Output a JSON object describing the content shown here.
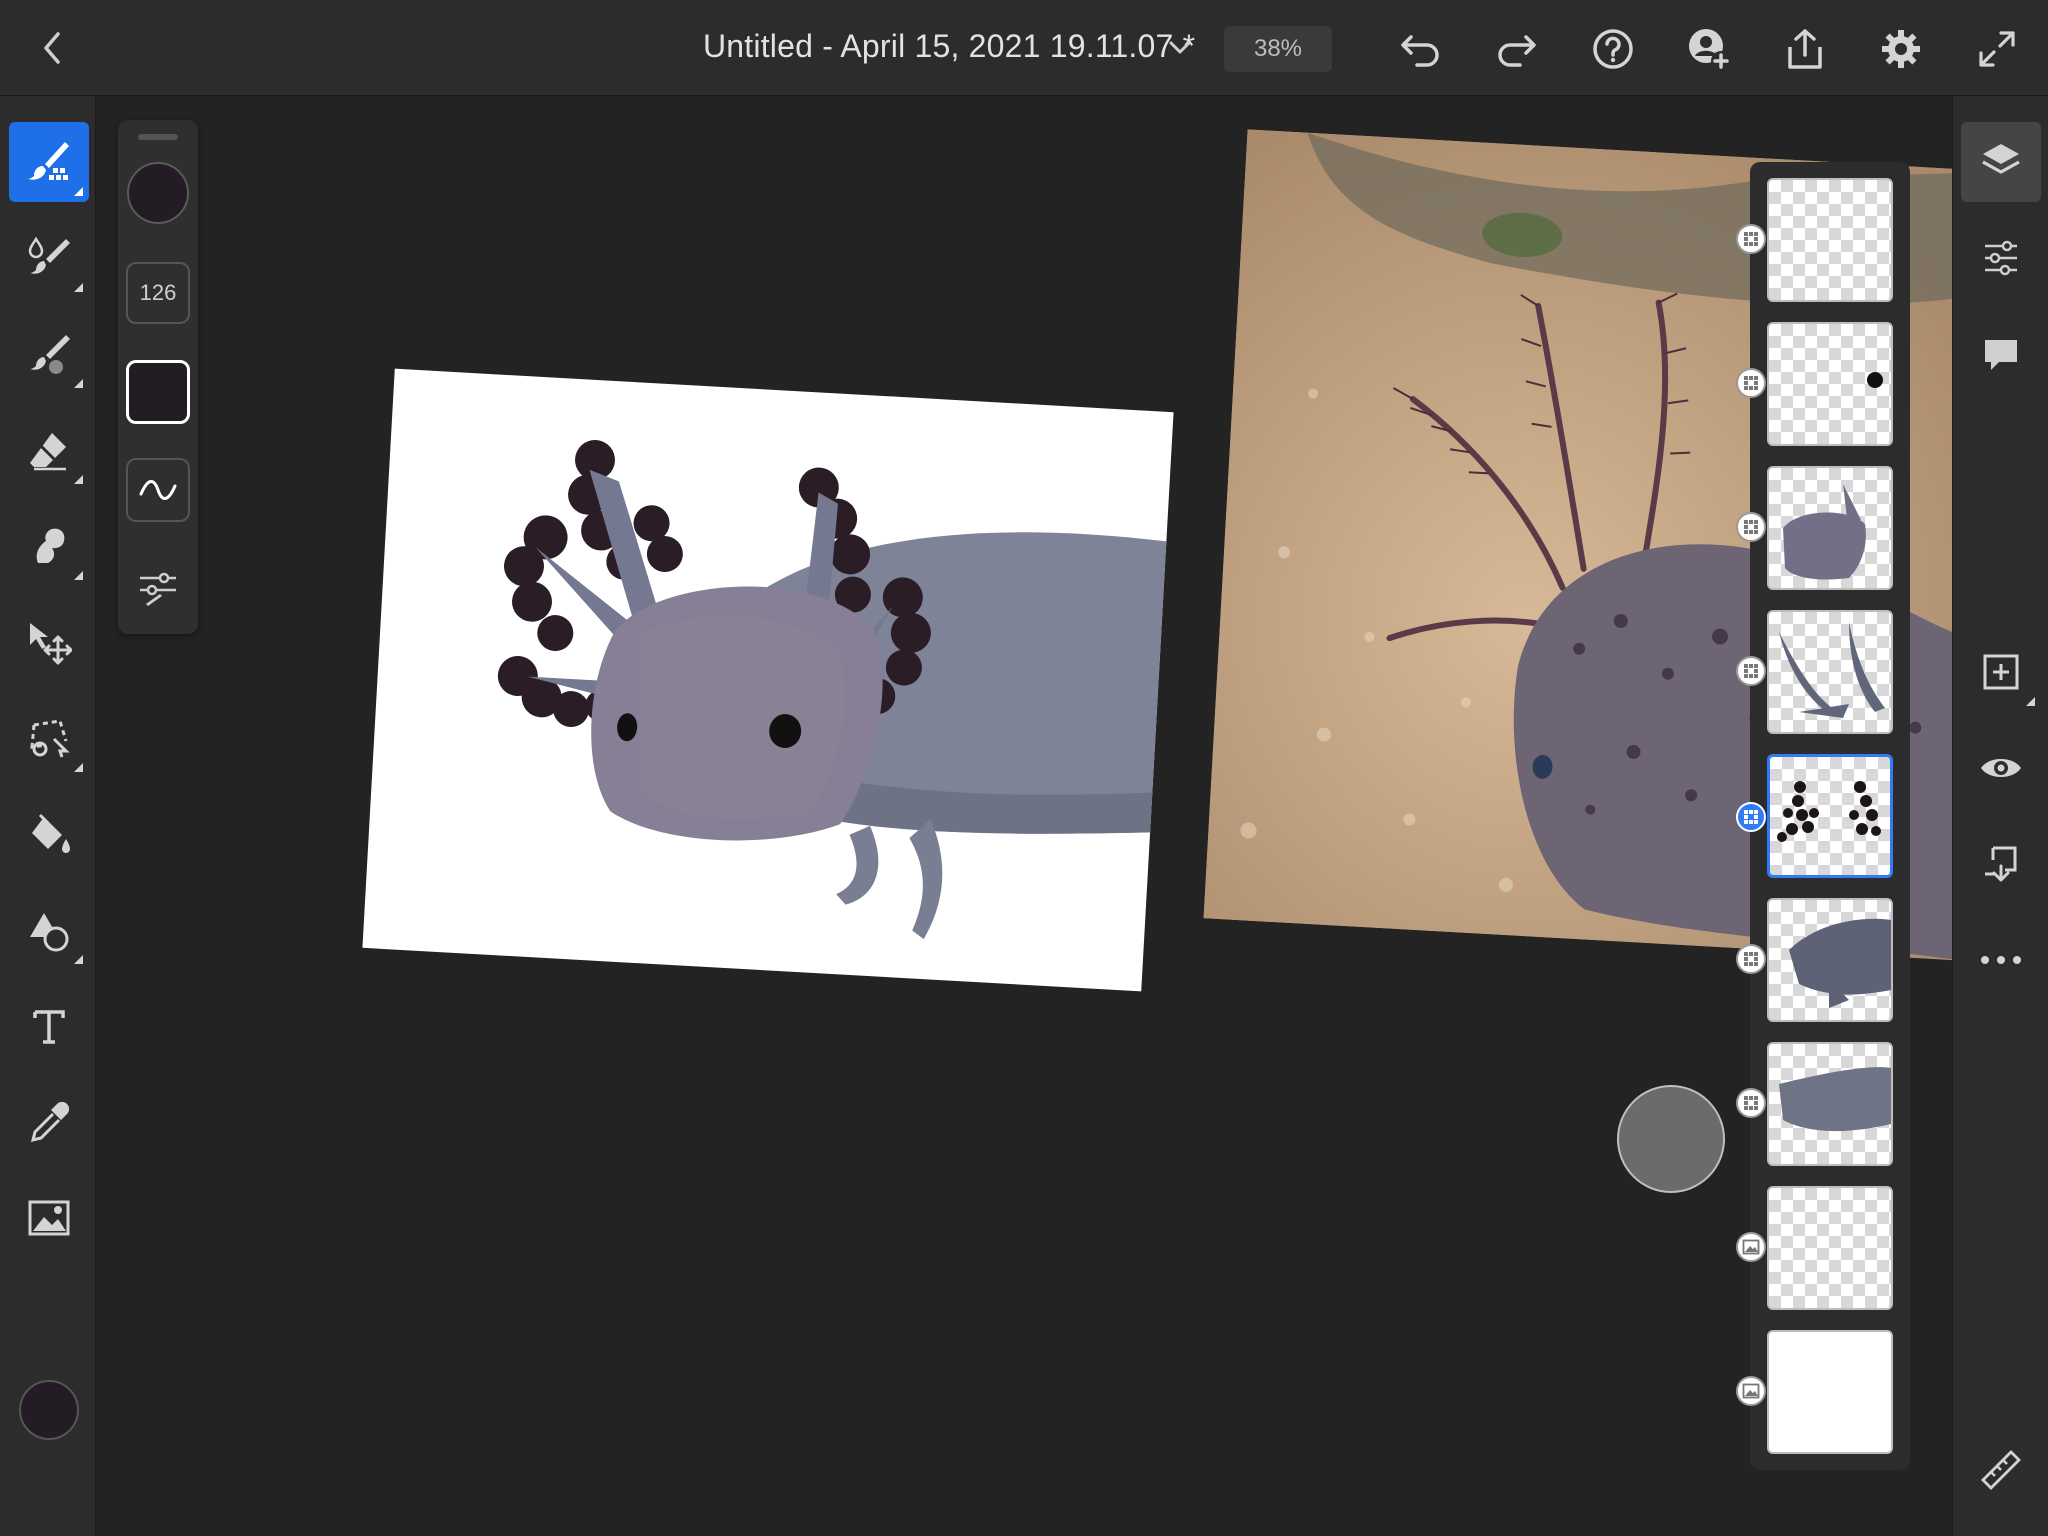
{
  "app": {
    "document_title": "Untitled - April 15, 2021 19.11.07 *",
    "zoom_level": "38%"
  },
  "topbar": {
    "icons": [
      "back-icon",
      "chevron-down-icon",
      "undo-icon",
      "redo-icon",
      "help-icon",
      "invite-icon",
      "share-icon",
      "gear-icon",
      "fullscreen-icon"
    ]
  },
  "tools": [
    {
      "name": "paint-brush",
      "icon": "paint-brush-icon",
      "active": true
    },
    {
      "name": "smudge",
      "icon": "smudge-brush-icon",
      "active": false
    },
    {
      "name": "mixer",
      "icon": "mixer-brush-icon",
      "active": false
    },
    {
      "name": "eraser",
      "icon": "eraser-icon",
      "active": false
    },
    {
      "name": "liquify",
      "icon": "liquify-icon",
      "active": false
    },
    {
      "name": "transform",
      "icon": "move-icon",
      "active": false
    },
    {
      "name": "selection",
      "icon": "lasso-icon",
      "active": false
    },
    {
      "name": "fill",
      "icon": "fill-bucket-icon",
      "active": false
    },
    {
      "name": "shapes",
      "icon": "shapes-icon",
      "active": false
    },
    {
      "name": "text",
      "icon": "text-icon",
      "active": false
    },
    {
      "name": "eyedropper",
      "icon": "eyedropper-icon",
      "active": false
    },
    {
      "name": "place-image",
      "icon": "image-icon",
      "active": false
    }
  ],
  "brush_panel": {
    "size": "126",
    "color": "#231c24"
  },
  "layers": [
    {
      "type": "pixel",
      "selected": false
    },
    {
      "type": "pixel",
      "selected": false
    },
    {
      "type": "pixel",
      "selected": false
    },
    {
      "type": "pixel",
      "selected": false
    },
    {
      "type": "pixel",
      "selected": true
    },
    {
      "type": "pixel",
      "selected": false
    },
    {
      "type": "pixel",
      "selected": false
    },
    {
      "type": "image",
      "selected": false
    },
    {
      "type": "image",
      "selected": false
    }
  ],
  "right_rail": {
    "icons": [
      "layers-icon",
      "layer-properties-icon",
      "comments-icon",
      "add-layer-icon",
      "visibility-icon",
      "merge-down-icon",
      "more-icon",
      "ruler-icon"
    ]
  },
  "colors": {
    "accent": "#1e6fe8",
    "panel": "#2c2c2c",
    "canvas_bg": "#232323",
    "current_color": "#231c24"
  }
}
